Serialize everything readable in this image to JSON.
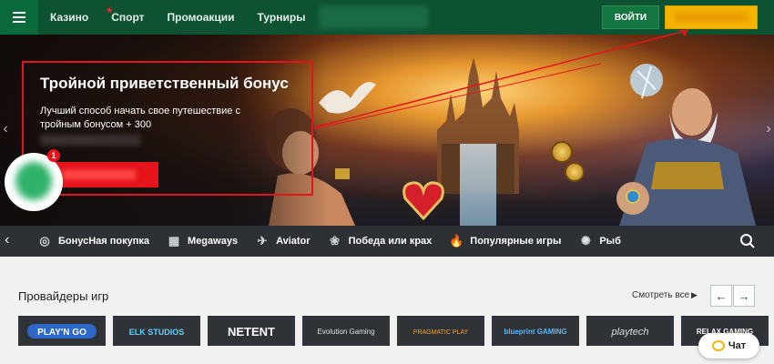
{
  "header": {
    "nav": [
      {
        "label": "Казино",
        "icon": ""
      },
      {
        "label": "Спорт",
        "icon": "star-icon"
      },
      {
        "label": "Промоакции",
        "icon": ""
      },
      {
        "label": "Турниры",
        "icon": ""
      }
    ],
    "login_label": "ВОЙТИ"
  },
  "banner": {
    "title": "Тройной приветственный бонус",
    "description": "Лучший способ начать свое путешествие с тройным бонусом + 300"
  },
  "notification": {
    "count": "1"
  },
  "categories": [
    {
      "label": "БонусНая покупка",
      "icon": "bonus-buy-icon",
      "glyph": "◎"
    },
    {
      "label": "Megaways",
      "icon": "slot-reels-icon",
      "glyph": "▦"
    },
    {
      "label": "Aviator",
      "icon": "airplane-icon",
      "glyph": "✈"
    },
    {
      "label": "Победа или крах",
      "icon": "cherries-icon",
      "glyph": "❀"
    },
    {
      "label": "Популярные игры",
      "icon": "fire-icon",
      "glyph": "🔥"
    },
    {
      "label": "Рыб",
      "icon": "fish-icon",
      "glyph": "✺"
    }
  ],
  "providers": {
    "title": "Провайдеры игр",
    "see_all": "Смотреть все",
    "items": [
      {
        "name": "PLAY'N GO"
      },
      {
        "name": "ELK STUDIOS"
      },
      {
        "name": "NETENT"
      },
      {
        "name": "Evolution Gaming"
      },
      {
        "name": "PRAGMATIC PLAY"
      },
      {
        "name": "blueprint GAMING"
      },
      {
        "name": "playtech"
      },
      {
        "name": "RELAX GAMING"
      }
    ]
  },
  "chat": {
    "label": "Чат"
  },
  "colors": {
    "brand": "#0d5233",
    "accent": "#f4b400",
    "promo": "#e5141b"
  }
}
